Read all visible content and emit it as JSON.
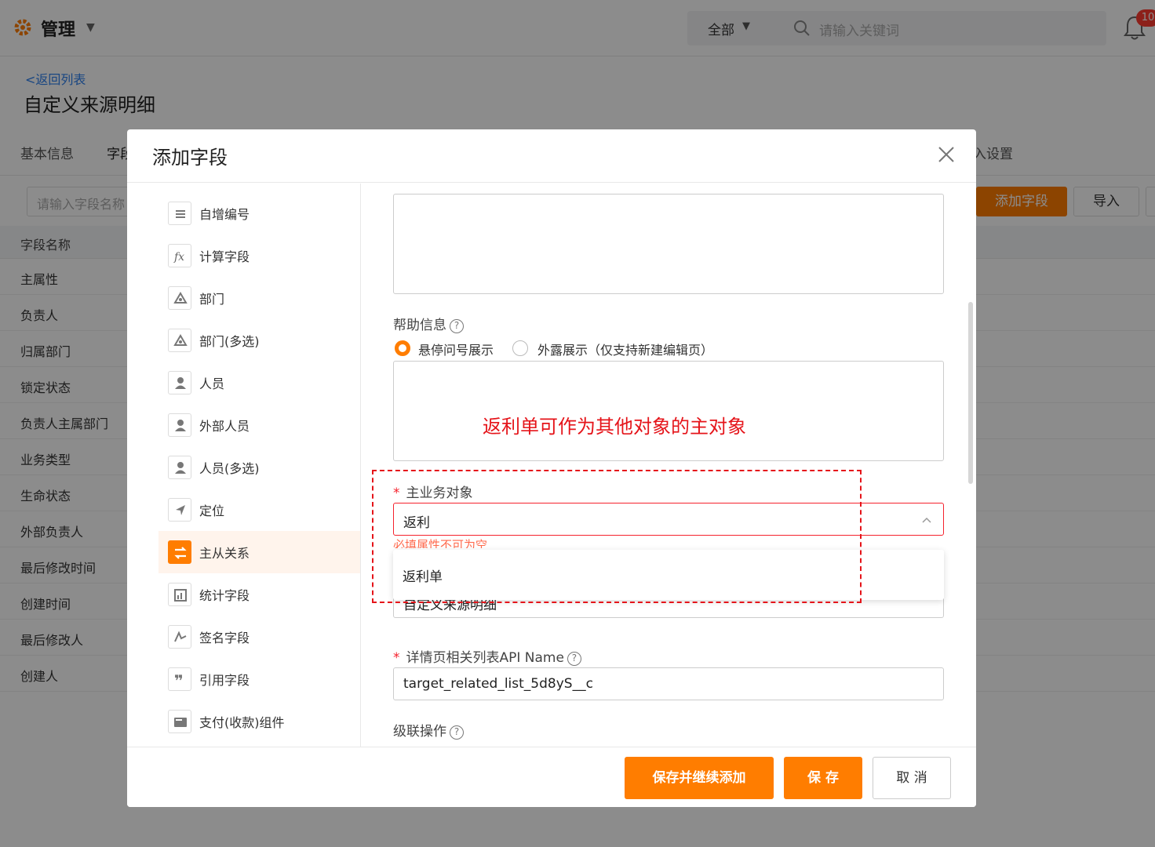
{
  "header": {
    "app_title": "管理",
    "search_scope": "全部",
    "search_placeholder": "请输入关键词",
    "notification_count": "10"
  },
  "page": {
    "back_link": "<返回列表",
    "title": "自定义来源明细"
  },
  "tabs": [
    {
      "label": "基本信息"
    },
    {
      "label": "字段"
    },
    {
      "label": "入设置"
    }
  ],
  "toolbar": {
    "field_search_placeholder": "请输入字段名称",
    "add_field_label": "添加字段",
    "import_label": "导入"
  },
  "table": {
    "header": "字段名称",
    "rows": [
      "主属性",
      "负责人",
      "归属部门",
      "锁定状态",
      "负责人主属部门",
      "业务类型",
      "生命状态",
      "外部负责人",
      "最后修改时间",
      "创建时间",
      "最后修改人",
      "创建人"
    ]
  },
  "modal": {
    "title": "添加字段",
    "field_types": [
      {
        "label": "自增编号",
        "icon": "list-icon"
      },
      {
        "label": "计算字段",
        "icon": "formula-icon"
      },
      {
        "label": "部门",
        "icon": "department-icon"
      },
      {
        "label": "部门(多选)",
        "icon": "department-icon"
      },
      {
        "label": "人员",
        "icon": "person-icon"
      },
      {
        "label": "外部人员",
        "icon": "person-icon"
      },
      {
        "label": "人员(多选)",
        "icon": "person-icon"
      },
      {
        "label": "定位",
        "icon": "location-icon"
      },
      {
        "label": "主从关系",
        "icon": "master-detail-icon",
        "active": true
      },
      {
        "label": "统计字段",
        "icon": "chart-icon"
      },
      {
        "label": "签名字段",
        "icon": "signature-icon"
      },
      {
        "label": "引用字段",
        "icon": "quote-icon"
      },
      {
        "label": "支付(收款)组件",
        "icon": "payment-icon"
      }
    ],
    "help_info_label": "帮助信息",
    "help_options": [
      "悬停问号展示",
      "外露展示（仅支持新建编辑页）"
    ],
    "help_selected": "悬停问号展示",
    "annotation": "返利单可作为其他对象的主对象",
    "master_object_label": "主业务对象",
    "master_object_value": "返利",
    "master_object_error": "必填属性不可为空",
    "dropdown_option": "返利单",
    "related_name_value": "自定义来源明细",
    "api_name_label": "详情页相关列表API Name",
    "api_name_value": "target_related_list_5d8yS__c",
    "cascade_label": "级联操作",
    "footer": {
      "save_continue": "保存并继续添加",
      "save": "保 存",
      "cancel": "取 消"
    }
  },
  "colors": {
    "accent": "#ff7d00",
    "error": "#f5222d",
    "annotation": "#e5141a",
    "link": "#2f80ed"
  }
}
